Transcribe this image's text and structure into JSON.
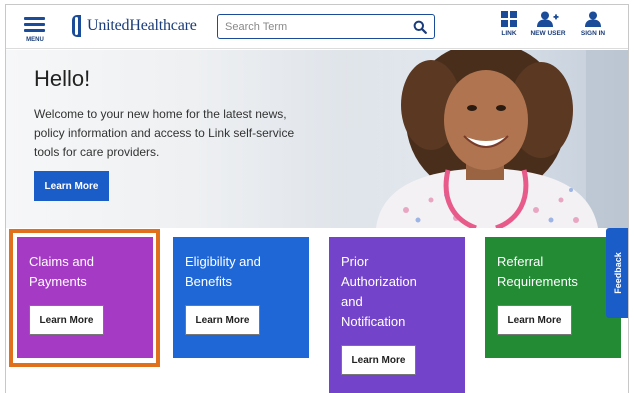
{
  "header": {
    "menu_label": "MENU",
    "logo_text": "UnitedHealthcare",
    "search_placeholder": "Search Term",
    "actions": [
      {
        "label": "LINK",
        "icon": "grid-icon"
      },
      {
        "label": "NEW USER",
        "icon": "add-user-icon"
      },
      {
        "label": "SIGN IN",
        "icon": "user-icon"
      }
    ]
  },
  "hero": {
    "title": "Hello!",
    "text": "Welcome to your new home for the latest news, policy information and access to Link self-service tools for care providers.",
    "button_label": "Learn More"
  },
  "cards": [
    {
      "title_lines": [
        "Claims and",
        "Payments"
      ],
      "button_label": "Learn More",
      "color": "#a53bc4"
    },
    {
      "title_lines": [
        "Eligibility and",
        "Benefits"
      ],
      "button_label": "Learn More",
      "color": "#1f67d6"
    },
    {
      "title_lines": [
        "Prior",
        "Authorization",
        "and",
        "Notification"
      ],
      "button_label": "Learn More",
      "color": "#7344c9"
    },
    {
      "title_lines": [
        "Referral",
        "Requirements"
      ],
      "button_label": "Learn More",
      "color": "#228b34"
    }
  ],
  "highlight_color": "#e0701c",
  "feedback_label": "Feedback",
  "colors": {
    "brand_blue": "#1a4c9a",
    "button_blue": "#1a5cc8"
  }
}
